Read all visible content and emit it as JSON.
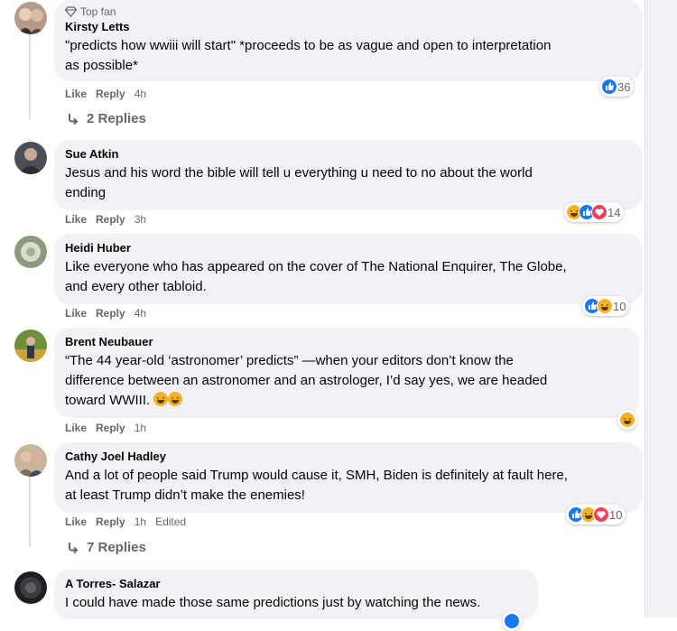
{
  "comments": [
    {
      "badge": "Top fan",
      "name": "Kirsty Letts",
      "text_lines": [
        "\"predicts how wwiii will start\" *proceeds to be as vague and open to interpretation",
        "as possible*"
      ],
      "like": "Like",
      "reply": "Reply",
      "time": "4h",
      "reactions": [
        "like"
      ],
      "reaction_count": "36",
      "replies": "2 Replies"
    },
    {
      "name": "Sue Atkin",
      "text_lines": [
        "Jesus and his word the bible will tell u everything u need to no about the world",
        "ending"
      ],
      "like": "Like",
      "reply": "Reply",
      "time": "3h",
      "reactions": [
        "haha",
        "like",
        "love"
      ],
      "reaction_count": "14"
    },
    {
      "name": "Heidi Huber",
      "text_lines": [
        "Like everyone who has appeared on the cover of The National Enquirer, The Globe,",
        "and every other tabloid."
      ],
      "like": "Like",
      "reply": "Reply",
      "time": "4h",
      "reactions": [
        "like",
        "haha"
      ],
      "reaction_count": "10"
    },
    {
      "name": "Brent Neubauer",
      "text_lines": [
        "“The 44 year-old ‘astronomer’ predicts” —when your editors don’t know the",
        "difference between an astronomer and an astrologer, I’d say yes, we are headed",
        "toward WWIII."
      ],
      "like": "Like",
      "reply": "Reply",
      "time": "1h",
      "reactions": [
        "haha"
      ],
      "reaction_count": ""
    },
    {
      "name": "Cathy Joel Hadley",
      "text_lines": [
        "And a lot of people said Trump would cause it, SMH, Biden is definitely at fault here,",
        "at least Trump didn’t make the enemies!"
      ],
      "like": "Like",
      "reply": "Reply",
      "time": "1h",
      "edited": "Edited",
      "reactions": [
        "like",
        "haha",
        "love"
      ],
      "reaction_count": "10",
      "replies": "7 Replies"
    },
    {
      "name": "A Torres- Salazar",
      "text_lines": [
        "I could have made those same predictions just by watching the news."
      ]
    }
  ],
  "colors": {
    "bubble": "#f0f2f5",
    "meta": "#65676b",
    "like_blue": "#1877f2",
    "haha_yellow": "#f7b125",
    "love_red": "#f33e58"
  }
}
